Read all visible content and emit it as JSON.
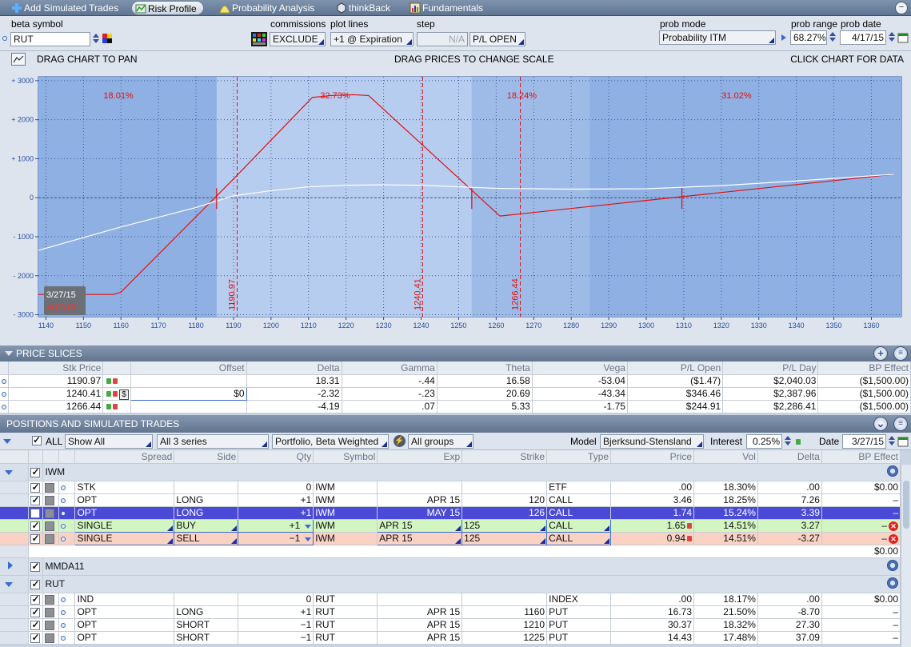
{
  "tabs": [
    {
      "label": "Add Simulated Trades",
      "icon": "plus-icon"
    },
    {
      "label": "Risk Profile",
      "icon": "risk-profile-icon",
      "active": true
    },
    {
      "label": "Probability Analysis",
      "icon": "probability-icon"
    },
    {
      "label": "thinkBack",
      "icon": "thinkback-icon"
    },
    {
      "label": "Fundamentals",
      "icon": "fundamentals-icon"
    }
  ],
  "controls": {
    "beta_symbol_label": "beta symbol",
    "beta_symbol_value": "RUT",
    "commissions_label": "commissions",
    "commissions_value": "EXCLUDE",
    "plot_lines_label": "plot lines",
    "plot_lines_value": "+1 @ Expiration",
    "step_label": "step",
    "step_value": "N/A",
    "pl_mode_value": "P/L OPEN",
    "prob_mode_label": "prob mode",
    "prob_mode_value": "Probability ITM",
    "prob_range_label": "prob range",
    "prob_range_value": "68.27%",
    "prob_date_label": "prob date",
    "prob_date_value": "4/17/15"
  },
  "chart_header": {
    "left": "DRAG CHART TO PAN",
    "center": "DRAG PRICES TO CHANGE SCALE",
    "right": "CLICK CHART FOR DATA"
  },
  "chart_data": {
    "type": "line",
    "xlim": [
      1138,
      1368
    ],
    "ylim": [
      -3050,
      3100
    ],
    "x_ticks": [
      1140,
      1150,
      1160,
      1170,
      1180,
      1190,
      1200,
      1210,
      1220,
      1230,
      1240,
      1250,
      1260,
      1270,
      1280,
      1290,
      1300,
      1310,
      1320,
      1330,
      1340,
      1350,
      1360
    ],
    "y_ticks": [
      {
        "v": 3000,
        "label": "+ 3000"
      },
      {
        "v": 2000,
        "label": "+ 2000"
      },
      {
        "v": 1000,
        "label": "+ 1000"
      },
      {
        "v": 0,
        "label": "0"
      },
      {
        "v": -1000,
        "label": "- 1000"
      },
      {
        "v": -2000,
        "label": "- 2000"
      },
      {
        "v": -3000,
        "label": "- 3000"
      }
    ],
    "grid": true,
    "series": [
      {
        "name": "4/17/15",
        "color": "#e01010",
        "x": [
          1138,
          1158,
          1160,
          1190,
          1211,
          1216,
          1222,
          1226,
          1261,
          1265,
          1300,
          1366
        ],
        "y": [
          -2480,
          -2480,
          -2420,
          480,
          2570,
          2620,
          2640,
          2620,
          -470,
          -430,
          -70,
          600
        ]
      },
      {
        "name": "3/27/15",
        "color": "#ffffff",
        "x": [
          1138,
          1160,
          1180,
          1190,
          1200,
          1210,
          1220,
          1230,
          1240,
          1250,
          1260,
          1270,
          1280,
          1300,
          1320,
          1340,
          1366
        ],
        "y": [
          -1350,
          -750,
          -250,
          50,
          180,
          280,
          320,
          330,
          320,
          280,
          240,
          230,
          220,
          230,
          310,
          430,
          600
        ]
      }
    ],
    "regions": [
      {
        "x_from": 1138,
        "x_to": 1185.5,
        "label": "18.01%"
      },
      {
        "x_from": 1185.5,
        "x_to": 1253.5,
        "label": "32.73%"
      },
      {
        "x_from": 1253.5,
        "x_to": 1285,
        "label": "18.24%"
      },
      {
        "x_from": 1285,
        "x_to": 1368,
        "label": "31.02%"
      }
    ],
    "price_lines": [
      {
        "x": 1190.97,
        "label": "1190.97"
      },
      {
        "x": 1240.41,
        "label": "1240.41"
      },
      {
        "x": 1266.44,
        "label": "1266.44"
      }
    ],
    "breakeven_marks": [
      1185.5,
      1253.5,
      1309.5
    ],
    "legend_dates": [
      "3/27/15",
      "4/17/15"
    ]
  },
  "price_slices": {
    "title": "PRICE SLICES",
    "headers": [
      "Stk Price",
      "Offset",
      "Delta",
      "Gamma",
      "Theta",
      "Vega",
      "P/L Open",
      "P/L Day",
      "BP Effect"
    ],
    "rows": [
      {
        "price": "1190.97",
        "offset": "",
        "delta": "18.31",
        "gamma": "-.44",
        "theta": "16.58",
        "vega": "-53.04",
        "pl_open": "($1.47)",
        "pl_day": "$2,040.03",
        "bp": "($1,500.00)"
      },
      {
        "price": "1240.41",
        "offset": "$0",
        "delta": "-2.32",
        "gamma": "-.23",
        "theta": "20.69",
        "vega": "-43.34",
        "pl_open": "$346.46",
        "pl_day": "$2,387.96",
        "bp": "($1,500.00)"
      },
      {
        "price": "1266.44",
        "offset": "",
        "delta": "-4.19",
        "gamma": ".07",
        "theta": "5.33",
        "vega": "-1.75",
        "pl_open": "$244.91",
        "pl_day": "$2,286.41",
        "bp": "($1,500.00)"
      }
    ],
    "dollar_btn": "$"
  },
  "positions": {
    "title": "POSITIONS AND SIMULATED TRADES",
    "filter": {
      "all_label": "ALL",
      "show": "Show All",
      "series": "All 3 series",
      "weighting": "Portfolio, Beta Weighted",
      "groups": "All groups",
      "model_label": "Model",
      "model": "Bjerksund-Stensland",
      "interest_label": "Interest",
      "interest": "0.25%",
      "date_label": "Date",
      "date": "3/27/15"
    },
    "headers": [
      "Spread",
      "Side",
      "Qty",
      "Symbol",
      "Exp",
      "Strike",
      "Type",
      "Price",
      "Vol",
      "Delta",
      "BP Effect"
    ],
    "groups": [
      {
        "name": "IWM",
        "expanded": true,
        "total": "$0.00",
        "rows": [
          {
            "spread": "STK",
            "side": "",
            "qty": "0",
            "symbol": "IWM",
            "exp": "",
            "strike": "",
            "type": "ETF",
            "price": ".00",
            "vol": "18.30%",
            "delta": ".00",
            "bp": "$0.00",
            "style": ""
          },
          {
            "spread": "OPT",
            "side": "LONG",
            "qty": "+1",
            "symbol": "IWM",
            "exp": "APR 15",
            "strike": "120",
            "type": "CALL",
            "price": "3.46",
            "vol": "18.25%",
            "delta": "7.26",
            "bp": "–",
            "style": ""
          },
          {
            "spread": "OPT",
            "side": "LONG",
            "qty": "+1",
            "symbol": "IWM",
            "exp": "MAY 15",
            "strike": "126",
            "type": "CALL",
            "price": "1.74",
            "vol": "15.24%",
            "delta": "3.39",
            "bp": "–",
            "style": "sel"
          },
          {
            "spread": "SINGLE",
            "side": "BUY",
            "qty": "+1",
            "symbol": "IWM",
            "exp": "APR 15",
            "strike": "125",
            "type": "CALL",
            "price": "1.65",
            "vol": "14.51%",
            "delta": "3.27",
            "bp": "–",
            "style": "buy"
          },
          {
            "spread": "SINGLE",
            "side": "SELL",
            "qty": "−1",
            "symbol": "IWM",
            "exp": "APR 15",
            "strike": "125",
            "type": "CALL",
            "price": "0.94",
            "vol": "14.51%",
            "delta": "-3.27",
            "bp": "–",
            "style": "sell"
          }
        ]
      },
      {
        "name": "MMDA11",
        "expanded": false
      },
      {
        "name": "RUT",
        "expanded": true,
        "rows": [
          {
            "spread": "IND",
            "side": "",
            "qty": "0",
            "symbol": "RUT",
            "exp": "",
            "strike": "",
            "type": "INDEX",
            "price": ".00",
            "vol": "18.17%",
            "delta": ".00",
            "bp": "$0.00",
            "style": ""
          },
          {
            "spread": "OPT",
            "side": "LONG",
            "qty": "+1",
            "symbol": "RUT",
            "exp": "APR 15",
            "strike": "1160",
            "type": "PUT",
            "price": "16.73",
            "vol": "21.50%",
            "delta": "-8.70",
            "bp": "–",
            "style": ""
          },
          {
            "spread": "OPT",
            "side": "SHORT",
            "qty": "−1",
            "symbol": "RUT",
            "exp": "APR 15",
            "strike": "1210",
            "type": "PUT",
            "price": "30.37",
            "vol": "18.32%",
            "delta": "27.30",
            "bp": "–",
            "style": ""
          },
          {
            "spread": "OPT",
            "side": "SHORT",
            "qty": "−1",
            "symbol": "RUT",
            "exp": "APR 15",
            "strike": "1225",
            "type": "PUT",
            "price": "14.43",
            "vol": "17.48%",
            "delta": "37.09",
            "bp": "–",
            "style": ""
          }
        ]
      }
    ]
  }
}
